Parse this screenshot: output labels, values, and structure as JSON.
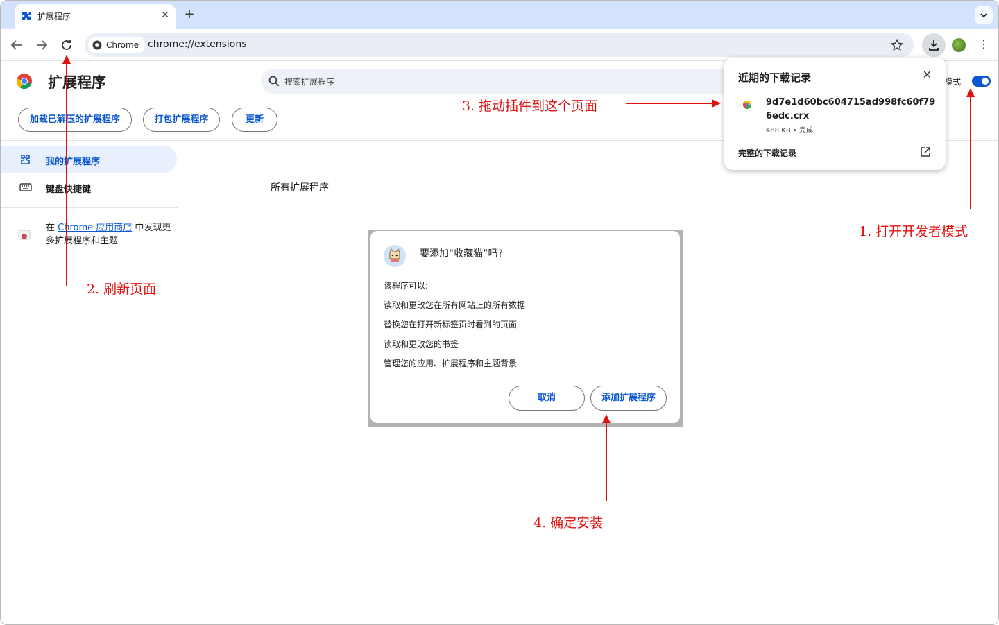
{
  "browser": {
    "tab_title": "扩展程序",
    "chip_label": "Chrome",
    "url": "chrome://extensions"
  },
  "page": {
    "title": "扩展程序",
    "search_placeholder": "搜索扩展程序",
    "dev_mode_label": "模式",
    "dev_mode_on": true,
    "buttons": {
      "load_unpacked": "加载已解压的扩展程序",
      "pack": "打包扩展程序",
      "update": "更新"
    },
    "section_title": "所有扩展程序"
  },
  "sidebar": {
    "items": [
      {
        "label": "我的扩展程序",
        "active": true
      },
      {
        "label": "键盘快捷键",
        "active": false
      }
    ],
    "store_prefix": "在 ",
    "store_link": "Chrome 应用商店",
    "store_suffix": " 中发现更多扩展程序和主题"
  },
  "downloads": {
    "title": "近期的下载记录",
    "file_name": "9d7e1d60bc604715ad998fc60f796edc.crx",
    "file_meta": "488 KB • 完成",
    "full_history": "完整的下载记录"
  },
  "dialog": {
    "title": "要添加“收藏猫”吗?",
    "subtitle": "该程序可以:",
    "permissions": [
      "读取和更改您在所有网站上的所有数据",
      "替换您在打开新标签页时看到的页面",
      "读取和更改您的书签",
      "管理您的应用、扩展程序和主题背景"
    ],
    "cancel": "取消",
    "confirm": "添加扩展程序"
  },
  "annotations": {
    "step1": "1. 打开开发者模式",
    "step2": "2. 刷新页面",
    "step3": "3. 拖动插件到这个页面",
    "step4": "4. 确定安装",
    "color": "#e0100f"
  },
  "colors": {
    "accent": "#0b57d0",
    "tabstrip": "#d3e3fd",
    "omnibox": "#e9eef6"
  }
}
